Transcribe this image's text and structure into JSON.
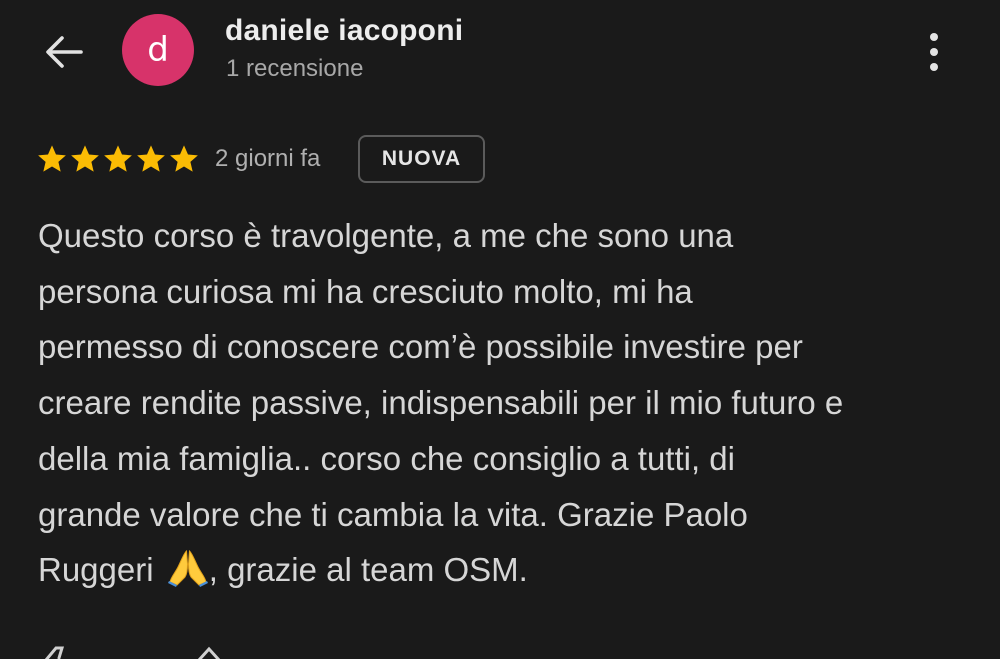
{
  "header": {
    "back_icon": "arrow-left-icon",
    "avatar_letter": "d",
    "avatar_color": "#d7336a",
    "user_name": "daniele iacoponi",
    "review_count": "1 recensione",
    "more_icon": "more-vertical-icon"
  },
  "rating": {
    "stars": 5,
    "max_stars": 5,
    "star_color": "#fbbc04",
    "date": "2 giorni fa",
    "badge": "NUOVA"
  },
  "review": {
    "lines": [
      "Questo corso è travolgente, a me che sono una",
      "persona curiosa mi ha cresciuto molto, mi ha",
      "permesso di conoscere com’è possibile investire per",
      "creare rendite passive, indispensabili per il mio futuro e",
      "della mia famiglia.. corso che consiglio a tutti, di",
      "grande valore che ti cambia la vita. Grazie Paolo"
    ],
    "last_line_before_emoji": "Ruggeri ",
    "emoji": "folded-hands-emoji",
    "last_line_after_emoji": ", grazie al team OSM."
  },
  "actions": {
    "icons": [
      "thumbs-up-icon",
      "share-icon"
    ]
  }
}
